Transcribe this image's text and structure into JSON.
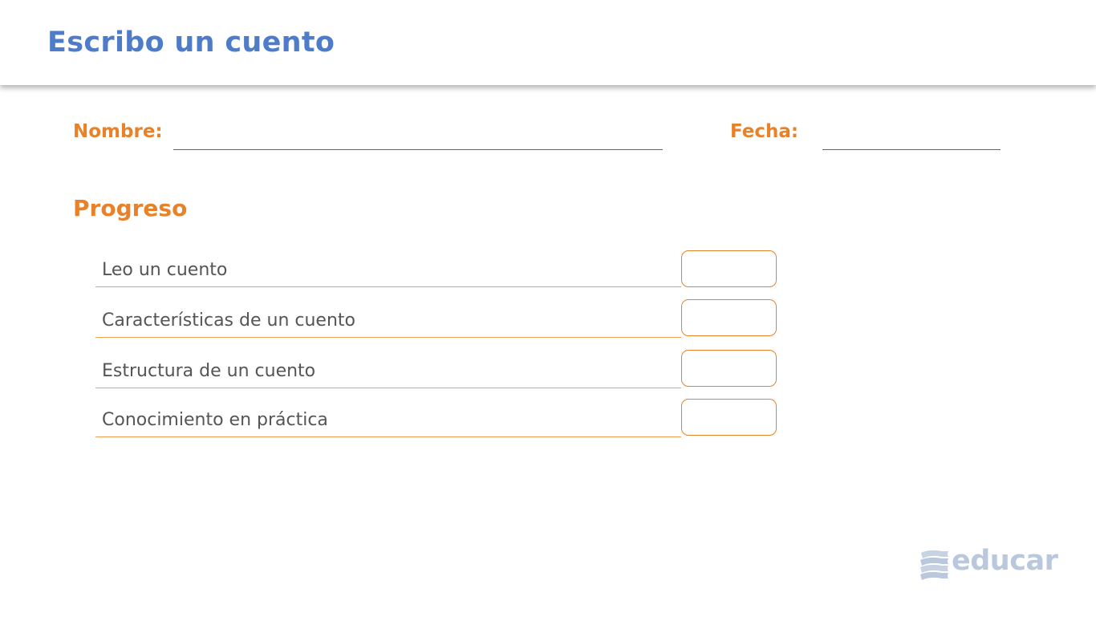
{
  "header": {
    "title": "Escribo un cuento"
  },
  "form": {
    "name_label": "Nombre:",
    "date_label": "Fecha:"
  },
  "progress": {
    "title": "Progreso",
    "items": [
      {
        "label": "Leo un cuento"
      },
      {
        "label": "Características de un cuento"
      },
      {
        "label": "Estructura de un cuento"
      },
      {
        "label": "Conocimiento en práctica"
      }
    ]
  },
  "logo": {
    "text": "educar",
    "icon": "stacked-books-icon"
  },
  "colors": {
    "title_blue": "#4f7cc9",
    "accent_orange": "#e8822a",
    "logo_gray": "#b9c8dc"
  }
}
